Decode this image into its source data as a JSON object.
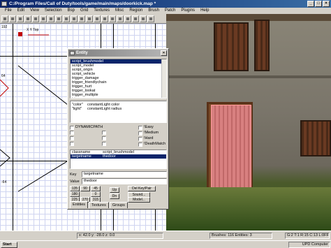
{
  "window": {
    "title": "C:/Program Files/Call of Duty/tools/game/main/maps/doorkick.map *",
    "controls": [
      "_",
      "□",
      "×"
    ]
  },
  "menu": [
    "File",
    "Edit",
    "View",
    "Selection",
    "Bsp",
    "Grid",
    "Textures",
    "Misc",
    "Region",
    "Brush",
    "Patch",
    "Plugins",
    "Help"
  ],
  "grid_view": {
    "label": "X Y Top",
    "coords": [
      "192",
      "64",
      "-64",
      "-128"
    ]
  },
  "entity_dialog": {
    "title": "Entity",
    "close": "×",
    "classnames": [
      "script_brushmodel",
      "script_model",
      "script_origin",
      "script_vehicle",
      "trigger_damage",
      "trigger_friendlychain",
      "trigger_hurt",
      "trigger_lookat",
      "trigger_multiple",
      "trigger_once"
    ],
    "selected_index": 0,
    "comment": [
      {
        "key": "\"color\"",
        "val": "constantLight color"
      },
      {
        "key": "\"light\"",
        "val": "constantLight radius"
      }
    ],
    "flags_left": [
      "DYNAMICPATH",
      "",
      "",
      ""
    ],
    "flags_right": [
      "!Easy",
      "!Medium",
      "!Hard",
      "!DeathMatch"
    ],
    "keyvalues": [
      {
        "key": "classname",
        "value": "script_brushmodel"
      },
      {
        "key": "targetname",
        "value": "thedoor"
      }
    ],
    "key_label": "Key",
    "key_value": "targetname",
    "value_label": "Value",
    "value_value": "thedoor",
    "angle_buttons": [
      "135",
      "90",
      "45",
      "180",
      "",
      "0",
      "225",
      "270",
      "315"
    ],
    "del_button": "Del Key/Pair",
    "sound_button": "Sound...",
    "model_button": "Model...",
    "up_button": "Up",
    "dn_button": "Dn",
    "tabs": [
      "Entities",
      "Textures",
      "Groups"
    ]
  },
  "status": {
    "coords": "x: 42.0  y: -28.0  z: 0.0",
    "brushes": "Brushes: 116  Entities: 3",
    "grid": "G:2 T:1 R:15 C:13 L:0FF"
  },
  "taskbar": {
    "start": "Start",
    "clock": "UPD Computer"
  }
}
